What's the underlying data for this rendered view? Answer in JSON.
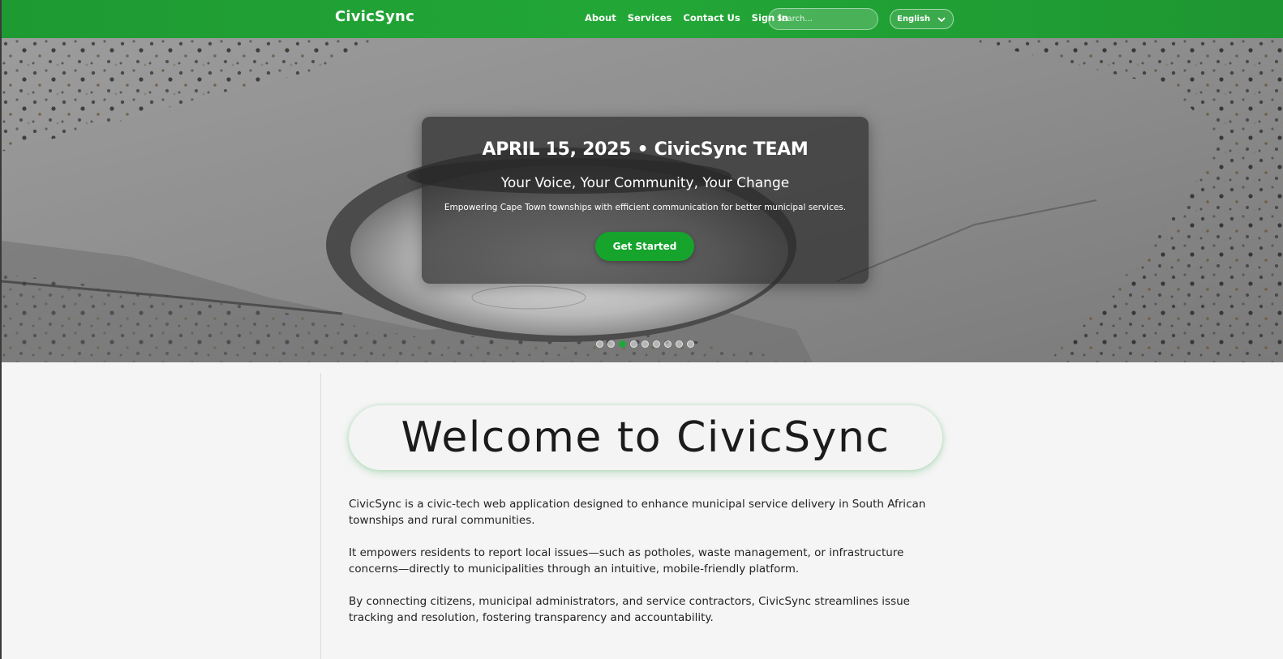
{
  "header": {
    "logo": "CivicSync",
    "nav": [
      {
        "label": "About"
      },
      {
        "label": "Services"
      },
      {
        "label": "Contact Us"
      },
      {
        "label": "Sign In"
      }
    ],
    "search_placeholder": "Search...",
    "language": "English",
    "accent_color": "#22a736"
  },
  "hero": {
    "date_line": "APRIL 15, 2025 • CivicSync TEAM",
    "tagline": "Your Voice, Your Community, Your Change",
    "description": "Empowering Cape Town townships with efficient communication for better municipal services.",
    "cta_label": "Get Started",
    "carousel": {
      "slide_count": 9,
      "active_index": 2
    }
  },
  "main": {
    "welcome_title": "Welcome to CivicSync",
    "paragraphs": [
      "CivicSync is a civic-tech web application designed to enhance municipal service delivery in South African townships and rural communities.",
      "It empowers residents to report local issues—such as potholes, waste management, or infrastructure concerns—directly to municipalities through an intuitive, mobile-friendly platform.",
      "By connecting citizens, municipal administrators, and service contractors, CivicSync streamlines issue tracking and resolution, fostering transparency and accountability."
    ]
  }
}
